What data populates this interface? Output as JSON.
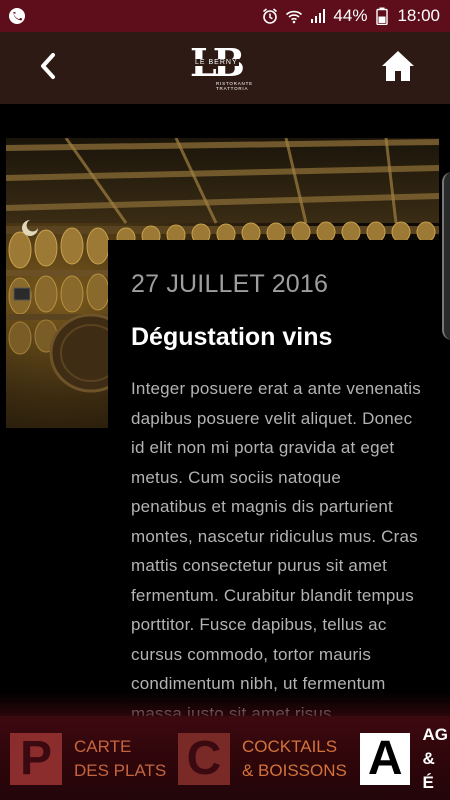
{
  "status_bar": {
    "battery": "44%",
    "time": "18:00",
    "icons": [
      "phone-icon",
      "alarm-icon",
      "wifi-icon",
      "signal-icon",
      "battery-icon"
    ]
  },
  "header": {
    "back_icon": "chevron-left-icon",
    "home_icon": "home-icon",
    "logo": {
      "mark": "LB",
      "name": "LE BERNY",
      "subtitle_line1": "RISTORANTE",
      "subtitle_line2": "TRATTORIA"
    }
  },
  "article": {
    "date": "27 JUILLET 2016",
    "title": "Dégustation vins",
    "body": "Integer posuere erat a ante venenatis dapibus posuere velit aliquet. Donec id elit non mi porta gravida at eget metus. Cum sociis natoque penatibus et magnis dis parturient montes, nascetur ridiculus mus. Cras mattis consectetur purus sit amet fermentum. Curabitur blandit tempus porttitor. Fusce dapibus, tellus ac cursus commodo, tortor mauris condimentum nibh, ut fermentum massa justo sit amet risus."
  },
  "bottom_nav": [
    {
      "letter": "P",
      "label": "CARTE\nDES PLATS"
    },
    {
      "letter": "C",
      "label": "COCKTAILS\n& BOISSONS"
    },
    {
      "letter": "A",
      "label": "AG\n& É"
    }
  ],
  "colors": {
    "status_bar": "#5e0e1b",
    "header": "#2d1a14",
    "background": "#000000",
    "date_text": "#9e9e9e",
    "body_text": "#b3b3b3",
    "nav_accent": "#c4653f"
  }
}
